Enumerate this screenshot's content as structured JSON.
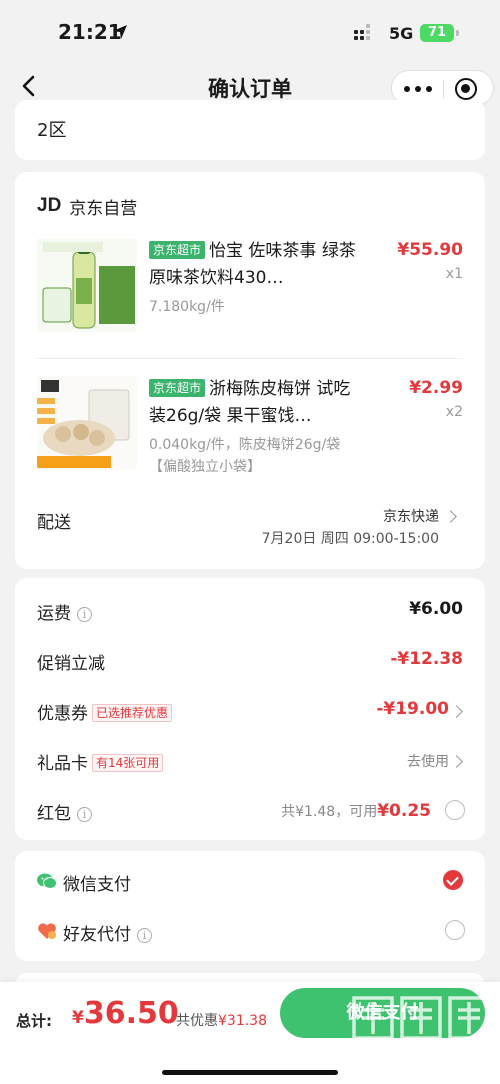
{
  "status_bar": {
    "time": "21:21",
    "network": "5G",
    "battery": "71"
  },
  "nav": {
    "title": "确认订单",
    "icons": [
      "back-icon",
      "more-icon",
      "target-icon"
    ]
  },
  "address": {
    "text": "2区"
  },
  "shop": {
    "logo": "JD",
    "name": "京东自营"
  },
  "products": [
    {
      "tag": "京东超市",
      "title": "怡宝 佐味茶事 绿茶 原味茶饮料430…",
      "spec": "7.180kg/件",
      "price": "¥55.90",
      "qty": "x1"
    },
    {
      "tag": "京东超市",
      "title": "浙梅陈皮梅饼 试吃装26g/袋 果干蜜饯…",
      "spec": "0.040kg/件，陈皮梅饼26g/袋【偏酸独立小袋】",
      "price": "¥2.99",
      "qty": "x2"
    }
  ],
  "delivery": {
    "label": "配送",
    "method": "京东快递",
    "time": "7月20日 周四 09:00-15:00"
  },
  "fees": {
    "shipping": {
      "label": "运费",
      "value": "¥6.00"
    },
    "promo": {
      "label": "促销立减",
      "value": "-¥12.38"
    },
    "coupon": {
      "label": "优惠券",
      "badge": "已选推荐优惠",
      "value": "-¥19.00"
    },
    "giftcard": {
      "label": "礼品卡",
      "badge": "有14张可用",
      "action": "去使用"
    },
    "redpacket": {
      "label": "红包",
      "note": "共¥1.48，可用",
      "value": "¥0.25"
    }
  },
  "payment": {
    "wechat": {
      "label": "微信支付",
      "selected": true
    },
    "friend": {
      "label": "好友代付",
      "selected": false
    }
  },
  "bottom": {
    "total_label": "总计:",
    "currency": "¥",
    "total": "36.50",
    "discount_prefix": "共优惠",
    "discount": "¥31.38",
    "pay_button": "微信支付"
  },
  "colors": {
    "accent_red": "#e4393c",
    "wechat_green": "#3ec26f",
    "tag_green": "#3cb46e"
  }
}
